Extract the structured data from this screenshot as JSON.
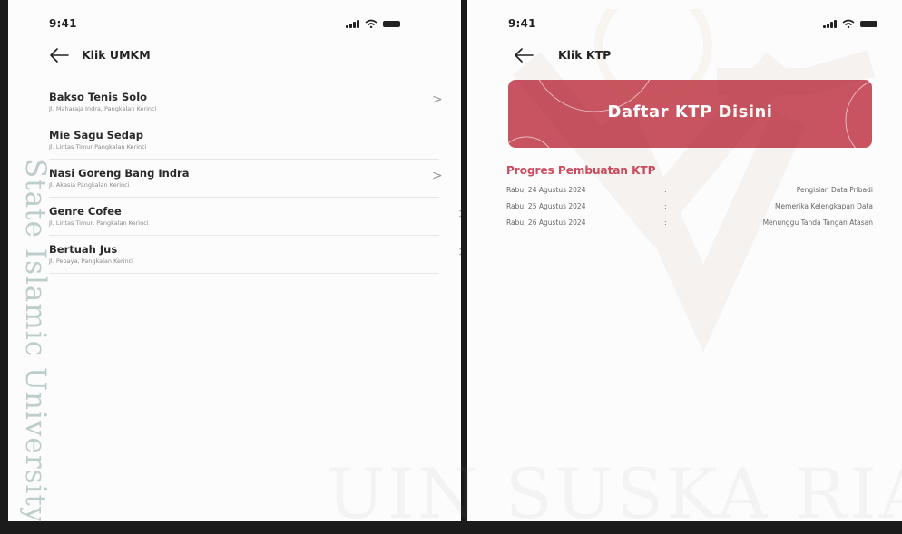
{
  "left_screen": {
    "status_bar": {
      "time": "9:41"
    },
    "header": {
      "title": "Klik UMKM"
    },
    "chevron": ">",
    "items": [
      {
        "name": "Bakso Tenis Solo",
        "address": "Jl. Maharaja Indra, Pangkalan Kerinci"
      },
      {
        "name": "Mie Sagu Sedap",
        "address": "Jl. Lintas Timur Pangkalan Kerinci"
      },
      {
        "name": "Nasi Goreng Bang Indra",
        "address": "Jl. Akasia Pangkalan Kerinci"
      },
      {
        "name": "Genre Cofee",
        "address": "Jl. Lintas Timur, Pangkalan Kerinci"
      },
      {
        "name": "Bertuah Jus",
        "address": "Jl. Pepaya, Pangkalan Kerinci"
      }
    ]
  },
  "right_screen": {
    "status_bar": {
      "time": "9:41"
    },
    "header": {
      "title": "Klik KTP"
    },
    "banner": {
      "label": "Daftar KTP Disini",
      "color": "#c85462"
    },
    "progress": {
      "title": "Progres Pembuatan KTP",
      "title_color": "#cc4a5d",
      "separator": ":",
      "rows": [
        {
          "date": "Rabu, 24 Agustus 2024",
          "status": "Pengisian Data Pribadi"
        },
        {
          "date": "Rabu, 25 Agustus 2024",
          "status": "Memerika Kelengkapan Data"
        },
        {
          "date": "Rabu, 26 Agustus 2024",
          "status": "Menunggu Tanda Tangan Atasan"
        }
      ]
    }
  },
  "watermark": {
    "vertical_text": "State Islamic University",
    "bottom_text": "UIN SUSKA RIAU"
  }
}
